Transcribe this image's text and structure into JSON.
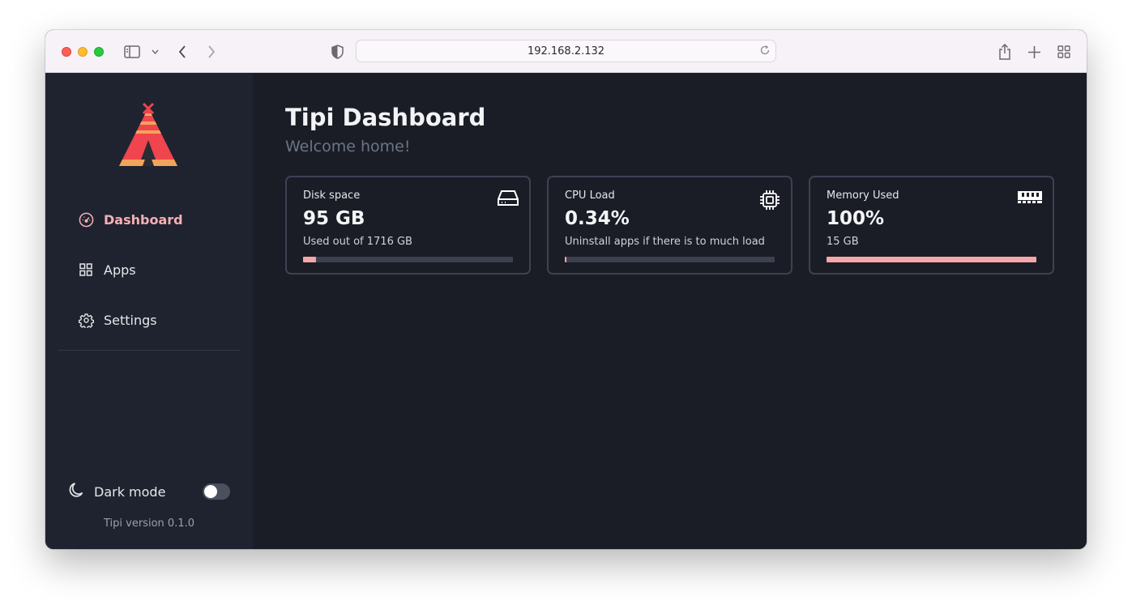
{
  "browser": {
    "url": "192.168.2.132"
  },
  "sidebar": {
    "nav": [
      {
        "label": "Dashboard",
        "icon": "dashboard-gauge-icon",
        "active": true
      },
      {
        "label": "Apps",
        "icon": "apps-grid-icon",
        "active": false
      },
      {
        "label": "Settings",
        "icon": "gear-icon",
        "active": false
      }
    ],
    "dark_mode_label": "Dark mode",
    "dark_mode_on": false,
    "version": "Tipi version 0.1.0"
  },
  "main": {
    "title": "Tipi Dashboard",
    "subtitle": "Welcome home!",
    "cards": [
      {
        "title": "Disk space",
        "value": "95 GB",
        "subtitle": "Used out of 1716 GB",
        "icon": "hard-drive-icon",
        "progress": 0.06
      },
      {
        "title": "CPU Load",
        "value": "0.34%",
        "subtitle": "Uninstall apps if there is to much load",
        "icon": "cpu-chip-icon",
        "progress": 0.0034
      },
      {
        "title": "Memory Used",
        "value": "100%",
        "subtitle": "15 GB",
        "icon": "memory-ram-icon",
        "progress": 1.0
      }
    ]
  },
  "colors": {
    "accent": "#f7a6aa",
    "sidebar_bg": "#1f2330",
    "main_bg": "#1a1d26",
    "card_border": "#3c4252"
  }
}
